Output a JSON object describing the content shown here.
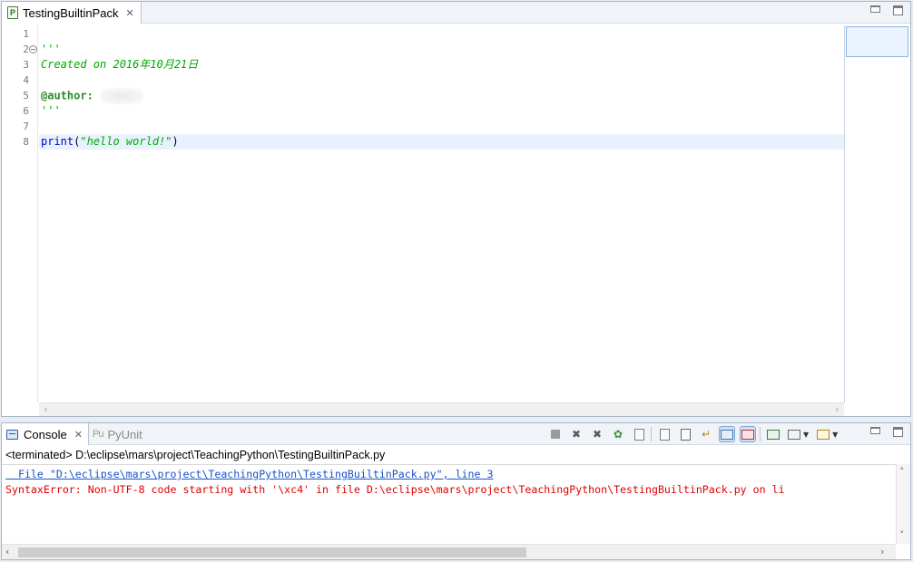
{
  "editor": {
    "tab_title": "TestingBuiltinPack",
    "tab_icon": "P",
    "close_glyph": "✕",
    "line_numbers": [
      "1",
      "2",
      "3",
      "4",
      "5",
      "6",
      "7",
      "8"
    ],
    "code": {
      "l2": "'''",
      "l3": "Created on 2016年10月21日",
      "l5": "@author:",
      "l6": "'''",
      "l8_kw": "print",
      "l8_open": "(",
      "l8_str": "\"hello world!\"",
      "l8_close": ")"
    },
    "colors": {
      "docstring": "#00aa00",
      "keyword": "#0000c0",
      "current_line": "#e8f2fe"
    }
  },
  "console": {
    "tab_title": "Console",
    "close_glyph": "✕",
    "pyunit_icon": "Pu",
    "pyunit_label": "PyUnit",
    "status": "<terminated> D:\\eclipse\\mars\\project\\TeachingPython\\TestingBuiltinPack.py",
    "output": {
      "trace_line": "  File \"D:\\eclipse\\mars\\project\\TeachingPython\\TestingBuiltinPack.py\", line 3",
      "error_line": "SyntaxError: Non-UTF-8 code starting with '\\xc4' in file D:\\eclipse\\mars\\project\\TeachingPython\\TestingBuiltinPack.py on li"
    },
    "colors": {
      "link": "#1a53c7",
      "error": "#e00000"
    }
  },
  "icons": {
    "terminate": "stop-icon",
    "remove_launch": "remove-launch-icon",
    "remove_all": "remove-all-icon",
    "debug": "debug-icon",
    "copy": "copy-icon",
    "clear": "clear-console-icon",
    "scroll_lock": "scroll-lock-icon",
    "word_wrap": "word-wrap-icon",
    "show_on_out": "show-on-output-icon",
    "show_on_err": "show-on-error-icon",
    "pin": "pin-icon",
    "display": "display-console-icon",
    "open_console": "open-console-icon"
  }
}
